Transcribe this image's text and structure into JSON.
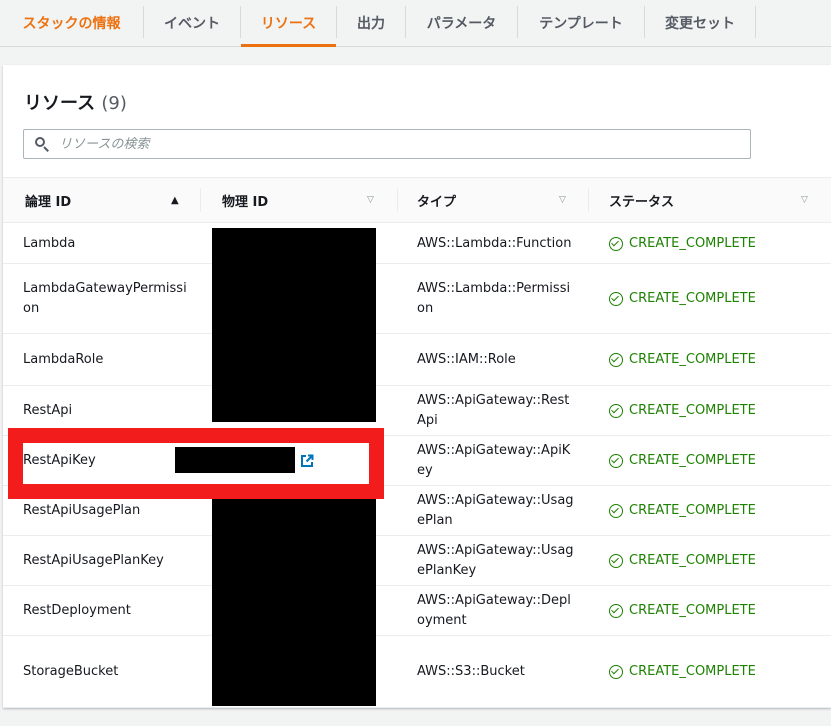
{
  "tabs": [
    {
      "label": "スタックの情報"
    },
    {
      "label": "イベント"
    },
    {
      "label": "リソース"
    },
    {
      "label": "出力"
    },
    {
      "label": "パラメータ"
    },
    {
      "label": "テンプレート"
    },
    {
      "label": "変更セット"
    }
  ],
  "active_tab": "リソース",
  "panel": {
    "title": "リソース",
    "count": "(9)"
  },
  "search": {
    "placeholder": "リソースの検索"
  },
  "columns": {
    "logical_id": "論理 ID",
    "physical_id": "物理 ID",
    "type": "タイプ",
    "status": "ステータス"
  },
  "rows": [
    {
      "logical_id": "Lambda",
      "type": "AWS::Lambda::Function",
      "status": "CREATE_COMPLETE"
    },
    {
      "logical_id": "LambdaGatewayPermission",
      "type": "AWS::Lambda::Permission",
      "status": "CREATE_COMPLETE"
    },
    {
      "logical_id": "LambdaRole",
      "type": "AWS::IAM::Role",
      "status": "CREATE_COMPLETE"
    },
    {
      "logical_id": "RestApi",
      "type": "AWS::ApiGateway::RestApi",
      "status": "CREATE_COMPLETE"
    },
    {
      "logical_id": "RestApiKey",
      "type": "AWS::ApiGateway::ApiKey",
      "status": "CREATE_COMPLETE"
    },
    {
      "logical_id": "RestApiUsagePlan",
      "type": "AWS::ApiGateway::UsagePlan",
      "status": "CREATE_COMPLETE"
    },
    {
      "logical_id": "RestApiUsagePlanKey",
      "type": "AWS::ApiGateway::UsagePlanKey",
      "status": "CREATE_COMPLETE"
    },
    {
      "logical_id": "RestDeployment",
      "type": "AWS::ApiGateway::Deployment",
      "status": "CREATE_COMPLETE"
    },
    {
      "logical_id": "StorageBucket",
      "type": "AWS::S3::Bucket",
      "status": "CREATE_COMPLETE"
    }
  ],
  "colors": {
    "accent": "#ec7211",
    "success": "#1d8102",
    "link": "#0073bb",
    "highlight": "#f21c1c"
  }
}
